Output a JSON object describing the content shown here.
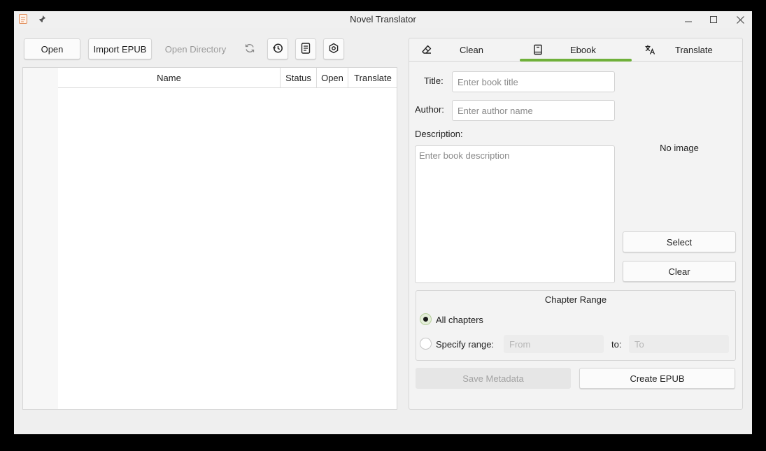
{
  "window": {
    "title": "Novel Translator",
    "controls": {
      "minimize": "–",
      "maximize": "□",
      "close": "✕"
    }
  },
  "toolbar": {
    "open_label": "Open",
    "import_epub_label": "Import EPUB",
    "open_directory_label": "Open Directory",
    "icons": [
      "refresh-icon",
      "history-icon",
      "document-icon",
      "settings-icon"
    ]
  },
  "table": {
    "columns": [
      "Name",
      "Status",
      "Open",
      "Translate"
    ],
    "rows": []
  },
  "tabs": [
    {
      "label": "Clean",
      "icon": "eraser-icon",
      "active": false
    },
    {
      "label": "Ebook",
      "icon": "book-icon",
      "active": true
    },
    {
      "label": "Translate",
      "icon": "translate-icon",
      "active": false
    }
  ],
  "ebook": {
    "title_label": "Title:",
    "title_placeholder": "Enter book title",
    "author_label": "Author:",
    "author_placeholder": "Enter author name",
    "description_label": "Description:",
    "description_placeholder": "Enter book description",
    "no_image_text": "No image",
    "select_label": "Select",
    "clear_label": "Clear",
    "chapter_range_title": "Chapter Range",
    "all_chapters_label": "All chapters",
    "specify_range_label": "Specify range:",
    "from_placeholder": "From",
    "to_label": "to:",
    "to_placeholder": "To",
    "selected_range": "all",
    "save_metadata_label": "Save Metadata",
    "create_epub_label": "Create EPUB"
  },
  "colors": {
    "accent": "#6fb03a",
    "window_bg": "#efefef"
  }
}
